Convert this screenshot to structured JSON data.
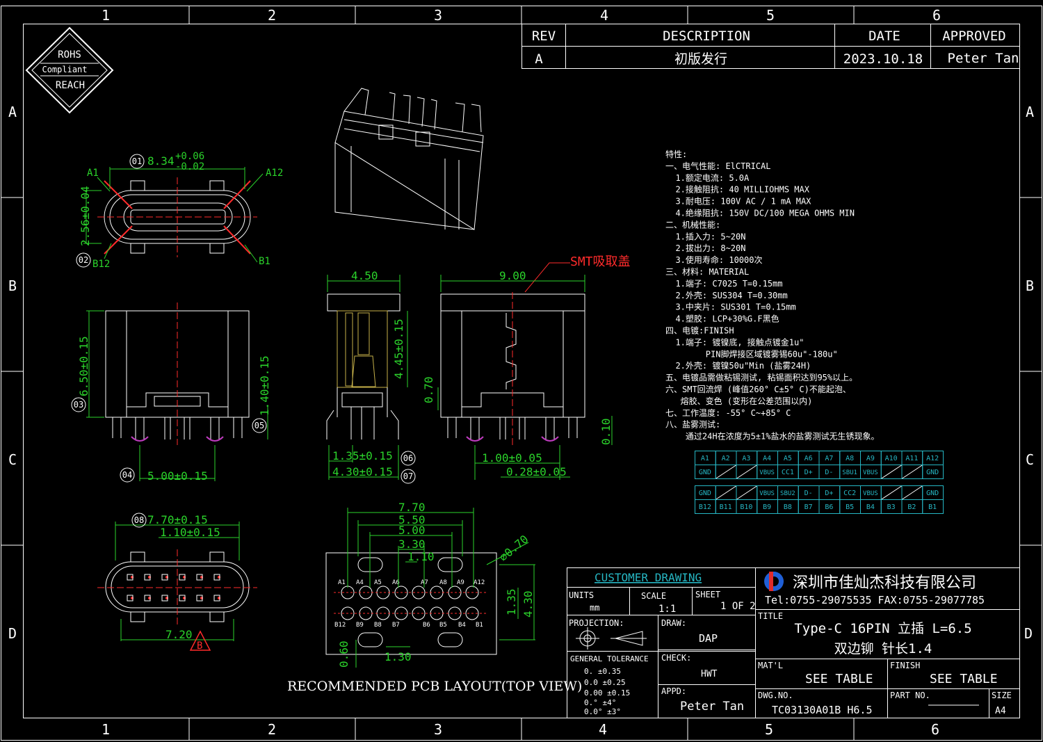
{
  "frame": {
    "col_labels": [
      "1",
      "2",
      "3",
      "4",
      "5",
      "6"
    ],
    "row_labels": [
      "A",
      "B",
      "C",
      "D"
    ]
  },
  "revision_table": {
    "headers": {
      "rev": "REV",
      "description": "DESCRIPTION",
      "date": "DATE",
      "approved": "APPROVED"
    },
    "row": {
      "rev": "A",
      "description": "初版发行",
      "date": "2023.10.18",
      "approved": "Peter Tan"
    }
  },
  "rohs_badge": {
    "line1": "ROHS",
    "line2": "Compliant",
    "line3": "REACH"
  },
  "dimensions": {
    "top_width": "8.34",
    "top_width_tol_plus": "+0.06",
    "top_width_tol_minus": "-0.02",
    "top_height": "2.56±0.04",
    "pin_a1": "A1",
    "pin_a12": "A12",
    "pin_b12": "B12",
    "pin_b1": "B1",
    "front_height": "6.50±0.15",
    "front_pin": "1.40±0.15",
    "front_pitch": "5.00±0.15",
    "side_width": "4.50",
    "side_height": "4.45±0.15",
    "side_foot1": "1.35±0.15",
    "side_foot2": "4.30±0.15",
    "side_gap": "0.70",
    "back_width": "9.00",
    "back_pin": "1.00±0.05",
    "back_pin2": "0.28±0.05",
    "back_h": "0.10",
    "smt_label": "SMT吸取盖",
    "bottom_width": "7.70±0.15",
    "bottom_gap": "1.10±0.15",
    "bottom_len": "7.20",
    "bottom_flag": "B"
  },
  "balloons": [
    "01",
    "02",
    "03",
    "04",
    "05",
    "06",
    "07",
    "08"
  ],
  "pcb": {
    "dims": [
      "7.70",
      "5.50",
      "5.00",
      "3.30",
      "1.10"
    ],
    "dia": "⌀0.70",
    "v1": "1.35",
    "v2": "4.30",
    "bot1": "0.60",
    "bot2": "1.30",
    "top_pins": [
      "A1",
      "A4",
      "A5",
      "A6",
      "A7",
      "A8",
      "A9",
      "A12"
    ],
    "bottom_pins": [
      "B12",
      "B9",
      "B8",
      "B7",
      "B6",
      "B5",
      "B4",
      "B1"
    ],
    "title": "RECOMMENDED PCB LAYOUT(TOP VIEW)"
  },
  "specs": [
    "特性:",
    "一、电气性能: ElCTRICAL",
    "  1.额定电流: 5.0A",
    "  2.接触阻抗: 40 MILLIOHMS MAX",
    "  3.耐电压: 100V AC / 1 mA MAX",
    "  4.绝缘阻抗: 150V DC/100 MEGA OHMS MIN",
    "二、机械性能:",
    "  1.插入力: 5~20N",
    "  2.拔出力: 8~20N",
    "  3.使用寿命: 10000次",
    "三、材料: MATERIAL",
    "  1.端子: C7025 T=0.15mm",
    "  2.外壳: SUS304 T=0.30mm",
    "  3.中夹片: SUS301 T=0.15mm",
    "  4.塑胶: LCP+30%G.F黑色",
    "四、电镀:FINISH",
    "  1.端子: 镀镍底, 接触点镀金1u\"",
    "        PIN脚焊接区域镀雾锡60u\"-180u\"",
    "  2.外壳: 镀镍50u\"Min (盐雾24H)",
    "五、电镀品需做粘锡测试, 粘锡面积达到95%以上。",
    "六、SMT回流焊 (峰值260° C±5° C)不能起泡、",
    "   熔胶、变色 (变形在公差范围以内)",
    "七、工作温度: -55° C~+85° C",
    "八、盐雾测试:",
    "    通过24H在浓度为5±1%盐水的盐雾测试无生锈现象。"
  ],
  "pin_table": {
    "row1": [
      "A1",
      "A2",
      "A3",
      "A4",
      "A5",
      "A6",
      "A7",
      "A8",
      "A9",
      "A10",
      "A11",
      "A12"
    ],
    "row2": [
      "GND",
      "",
      "",
      "VBUS",
      "CC1",
      "D+",
      "D-",
      "SBU1",
      "VBUS",
      "",
      "",
      "GND"
    ],
    "row3": [
      "GND",
      "",
      "",
      "VBUS",
      "SBU2",
      "D-",
      "D+",
      "CC2",
      "VBUS",
      "",
      "",
      "GND"
    ],
    "row4": [
      "B12",
      "B11",
      "B10",
      "B9",
      "B8",
      "B7",
      "B6",
      "B5",
      "B4",
      "B3",
      "B2",
      "B1"
    ]
  },
  "title_block": {
    "customer_drawing": "CUSTOMER DRAWING",
    "company": "深圳市佳灿杰科技有限公司",
    "contact": "Tel:0755-29075535 FAX:0755-29077785",
    "units_label": "UNITS",
    "units": "mm",
    "scale_label": "SCALE",
    "scale": "1:1",
    "sheet_label": "SHEET",
    "sheet": "1 OF 2",
    "title_label": "TITLE",
    "title1": "Type-C 16PIN 立插 L=6.5",
    "title2": "双边铆 针长1.4",
    "projection_label": "PROJECTION:",
    "draw_label": "DRAW:",
    "draw": "DAP",
    "general_tol": "GENERAL TOLERANCE",
    "tol": [
      "0.   ±0.35",
      "0.0  ±0.25",
      "0.00 ±0.15",
      "0.°  ±4°",
      "0.0° ±3°"
    ],
    "check_label": "CHECK:",
    "check": "HWT",
    "appd_label": "APPD:",
    "appd": "Peter Tan",
    "matl_label": "MAT'L",
    "matl": "SEE TABLE",
    "finish_label": "FINISH",
    "finish": "SEE TABLE",
    "dwg_label": "DWG.NO.",
    "dwg": "TC03130A01B H6.5",
    "part_label": "PART NO.",
    "size_label": "SIZE",
    "size": "A4"
  },
  "colors": {
    "line": "#ffffff",
    "dim": "#2bd42b",
    "table": "#26b7c4",
    "accent": "#ff2b2b"
  }
}
